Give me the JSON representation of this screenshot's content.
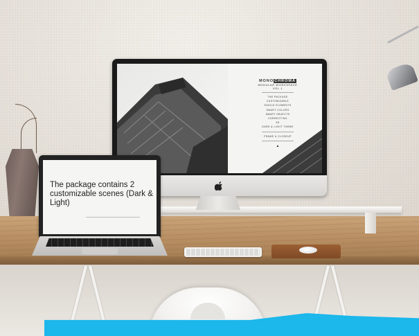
{
  "monitor": {
    "logo_part1": "MONO",
    "logo_part2": "CHROMA",
    "subtitle_line1": "MODULAR WORKSPACE",
    "subtitle_line2": "VOL.1",
    "menu_items": [
      "THE PACKAGE",
      "CUSTOMIZABLE",
      "SINGLE ELEMENTS",
      "SMART COLORS",
      "SMART OBJECTS",
      "CORRECTING",
      "3D",
      "DARK & LIGHT THEME"
    ],
    "menu_footer": "FRAME & CLOSEUP",
    "footer_icon": "▲"
  },
  "laptop": {
    "screen_text": "The package contains 2 customizable scenes (Dark & Light)"
  },
  "colors": {
    "accent": "#1cb7eb",
    "wood": "#b88f63"
  }
}
